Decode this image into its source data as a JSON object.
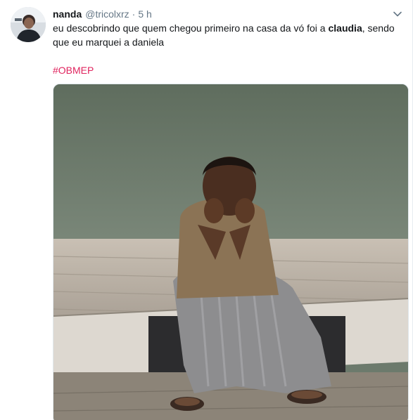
{
  "tweet": {
    "display_name": "nanda",
    "handle": "@tricolxrz",
    "separator": "·",
    "time": "5 h",
    "text_part1": "eu descobrindo que quem chegou primeiro na casa da vó foi a ",
    "text_bold": "claudia",
    "text_part2": ", sendo que eu marquei a daniela",
    "hashtag": "#OBMEP"
  },
  "icons": {
    "avatar": "user-avatar",
    "caret": "chevron-down-icon"
  },
  "colors": {
    "hashtag": "#e0245e",
    "text": "#14171a",
    "secondary": "#657786"
  }
}
